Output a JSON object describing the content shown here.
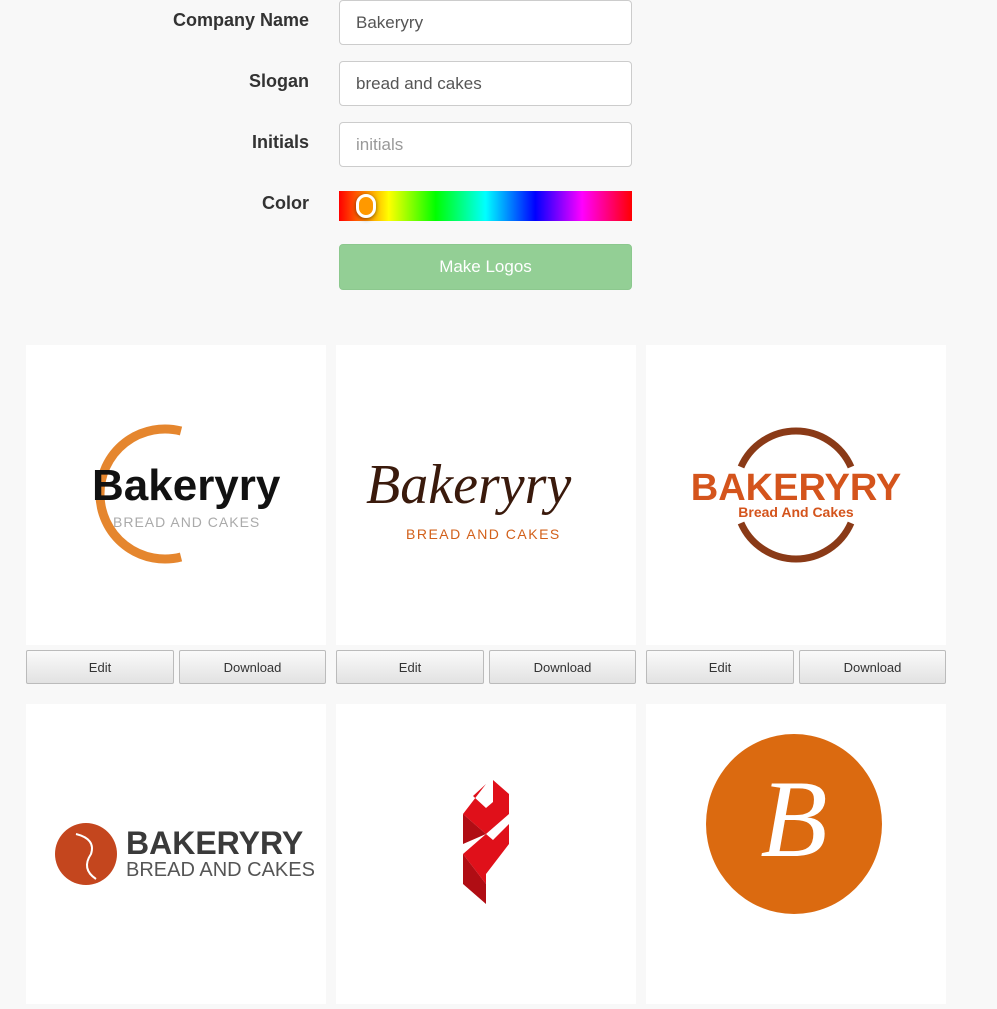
{
  "form": {
    "company_label": "Company Name",
    "company_value": "Bakeryry",
    "slogan_label": "Slogan",
    "slogan_value": "bread and cakes",
    "initials_label": "Initials",
    "initials_placeholder": "initials",
    "color_label": "Color",
    "color_selected": "#ff9900",
    "make_button": "Make Logos"
  },
  "logos": [
    {
      "name": "Bakeryry",
      "slogan": "BREAD AND CAKES",
      "edit": "Edit",
      "download": "Download"
    },
    {
      "name": "Bakeryry",
      "slogan": "BREAD AND CAKES",
      "edit": "Edit",
      "download": "Download"
    },
    {
      "name": "BAKERYRY",
      "slogan": "Bread And Cakes",
      "edit": "Edit",
      "download": "Download"
    },
    {
      "name": "BAKERYRY",
      "slogan": "BREAD AND CAKES"
    },
    {},
    {
      "initial": "B"
    }
  ]
}
